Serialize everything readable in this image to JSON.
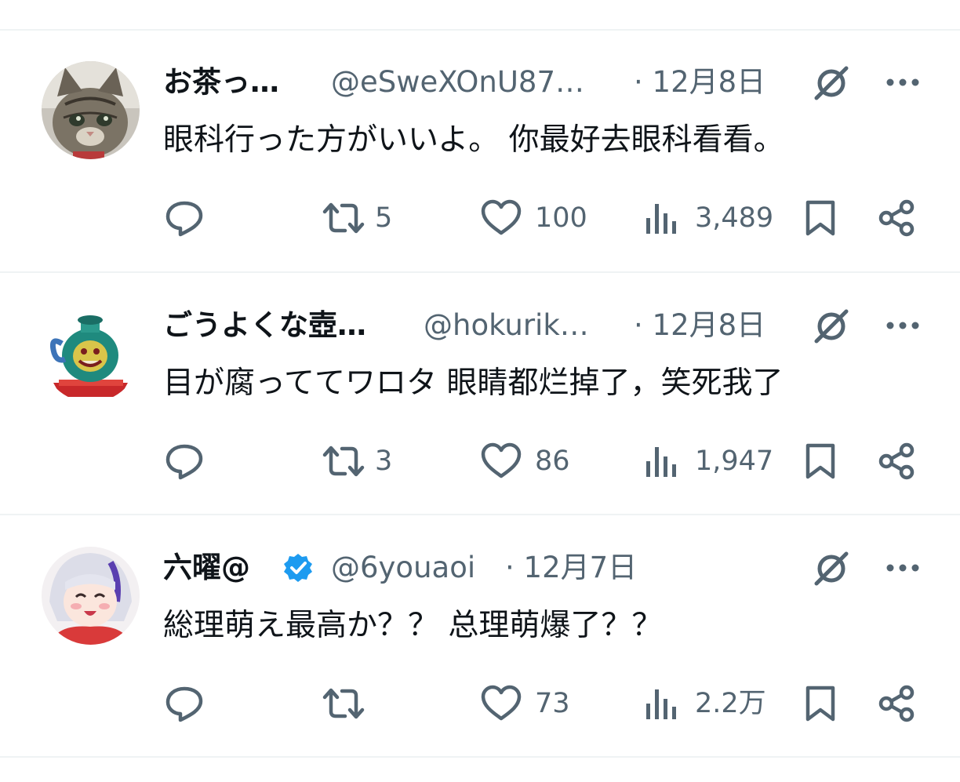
{
  "tweets": [
    {
      "name": "お茶っ…",
      "handle": "@eSweXOnU87…",
      "date": "· 12月8日",
      "verified": false,
      "text": "眼科行った方がいいよ。 你最好去眼科看看。",
      "reply_count": "",
      "retweet_count": "5",
      "like_count": "100",
      "view_count": "3,489",
      "avatar_icon": "cat-avatar"
    },
    {
      "name": "ごうよくな壺…",
      "handle": "@hokurik…",
      "date": "· 12月8日",
      "verified": false,
      "text": "目が腐っててワロタ 眼睛都烂掉了，笑死我了",
      "reply_count": "",
      "retweet_count": "3",
      "like_count": "86",
      "view_count": "1,947",
      "avatar_icon": "pot-of-greed-avatar"
    },
    {
      "name": "六曜@",
      "handle": "@6youaoi",
      "date": "· 12月7日",
      "verified": true,
      "text": "総理萌え最高か？？ 总理萌爆了？？",
      "reply_count": "",
      "retweet_count": "",
      "like_count": "73",
      "view_count": "2.2万",
      "avatar_icon": "anime-girl-avatar"
    }
  ],
  "icons": {
    "reply": "reply-icon",
    "retweet": "retweet-icon",
    "like": "heart-icon",
    "views": "views-icon",
    "bookmark": "bookmark-icon",
    "share": "share-icon",
    "grok": "grok-icon",
    "more": "more-icon",
    "verified": "verified-badge-icon"
  },
  "colors": {
    "text": "#0f1419",
    "secondary": "#536471",
    "divider": "#eff3f4",
    "verified": "#1d9bf0"
  }
}
